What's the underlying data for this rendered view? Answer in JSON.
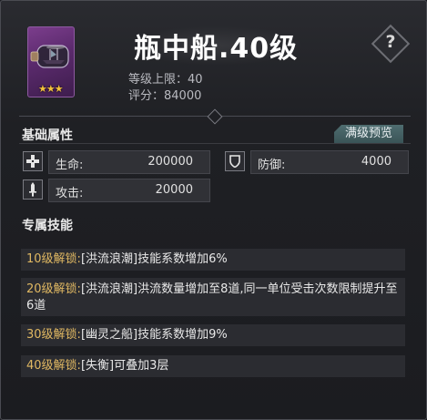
{
  "item": {
    "title": "瓶中船.40级",
    "stars": "★★★",
    "level_cap": "等级上限：40",
    "score": "评分：84000"
  },
  "help_label": "?",
  "basic": {
    "heading": "基础属性",
    "preview_button": "满级预览",
    "hp_label": "生命:",
    "hp_value": "200000",
    "def_label": "防御:",
    "def_value": "4000",
    "atk_label": "攻击:",
    "atk_value": "20000"
  },
  "skills": {
    "heading": "专属技能",
    "items": [
      {
        "level": "10级解锁:",
        "text": "[洪流浪潮]技能系数增加6%"
      },
      {
        "level": "20级解锁:",
        "text": "[洪流浪潮]洪流数量增加至8道,同一单位受击次数限制提升至6道"
      },
      {
        "level": "30级解锁:",
        "text": "[幽灵之船]技能系数增加9%"
      },
      {
        "level": "40级解锁:",
        "text": "[失衡]可叠加3层"
      }
    ]
  },
  "colors": {
    "accent_gold": "#e0b862",
    "star": "#f2c23b",
    "button": "#4f6d70",
    "thumb": "#7b3d8c"
  },
  "icons": [
    "ship-in-bottle-image",
    "star-icon",
    "help-icon",
    "cross-icon",
    "shield-icon",
    "sword-icon"
  ]
}
